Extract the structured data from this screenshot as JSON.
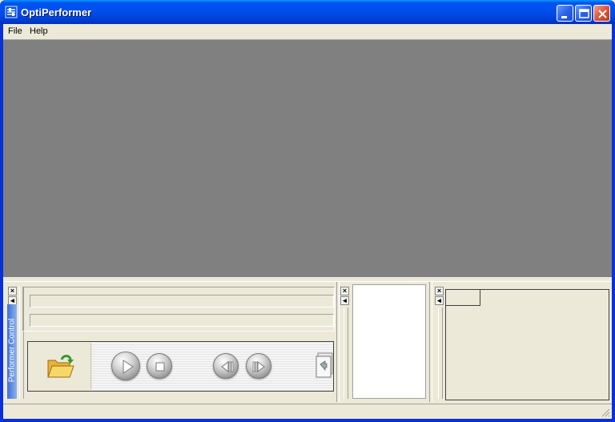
{
  "window": {
    "title": "OptiPerformer",
    "accent": "#0050ee",
    "close_color": "#e0553a"
  },
  "menu": {
    "items": [
      {
        "label": "File"
      },
      {
        "label": "Help"
      }
    ]
  },
  "viewport": {
    "background": "#808080"
  },
  "dock": {
    "close_glyph": "×",
    "arrow_glyph": "◂"
  },
  "performer_control": {
    "label": "Performer Control",
    "buttons": [
      {
        "name": "open-folder-icon"
      },
      {
        "name": "play-icon"
      },
      {
        "name": "stop-icon"
      },
      {
        "name": "step-back-icon"
      },
      {
        "name": "step-forward-icon"
      },
      {
        "name": "copy-frame-icon"
      }
    ]
  }
}
